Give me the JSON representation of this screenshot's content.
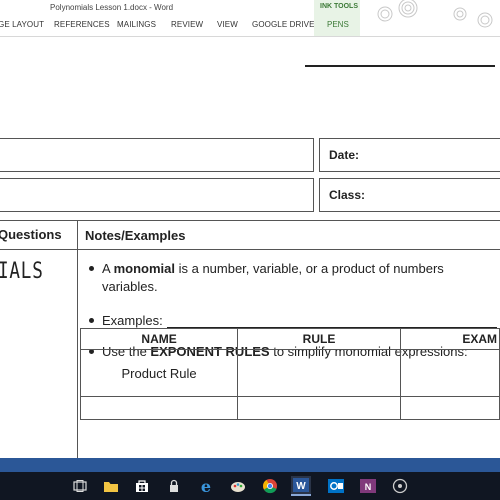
{
  "window": {
    "title": "Polynomials Lesson 1.docx - Word"
  },
  "ribbon": {
    "tabs": [
      "GE LAYOUT",
      "REFERENCES",
      "MAILINGS",
      "REVIEW",
      "VIEW",
      "GOOGLE DRIVE"
    ],
    "contextual_group": "INK TOOLS",
    "contextual_tab": "PENS",
    "accent": "#3c7a37"
  },
  "document": {
    "date_label": "Date:",
    "class_label": "Class:",
    "questions_header": "Questions",
    "notes_header": "Notes/Examples",
    "section_title": "IALS",
    "bullet1_pre": "A ",
    "bullet1_bold": "monomial",
    "bullet1_post": " is a number, variable, or a product of numbers",
    "bullet1_line2": "variables.",
    "bullet2": "Examples:",
    "bullet3_pre": "Use the ",
    "bullet3_bold": "EXPONENT RULES",
    "bullet3_post": " to simplify monomial expressions:",
    "table": {
      "headers": [
        "NAME",
        "RULE",
        "EXAM"
      ],
      "rows": [
        [
          "Product Rule",
          "",
          ""
        ]
      ]
    }
  },
  "taskbar": {
    "color": "#101622",
    "strip_color": "#2b5797",
    "icons": [
      "task-view-icon",
      "file-explorer-icon",
      "store-icon",
      "edge-icon",
      "paint-icon",
      "chrome-icon",
      "word-icon",
      "outlook-icon",
      "onenote-icon",
      "media-icon"
    ]
  }
}
